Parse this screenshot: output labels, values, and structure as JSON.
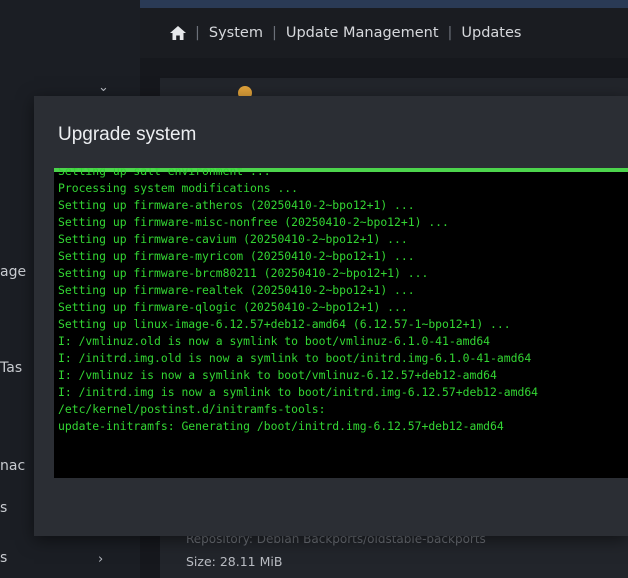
{
  "sidebar": {
    "fragments": [
      "",
      "age",
      "Tas",
      "nac",
      "s",
      "s"
    ]
  },
  "breadcrumb": {
    "home_icon": "home-icon",
    "items": [
      "System",
      "Update Management",
      "Updates"
    ]
  },
  "background_package": {
    "repository": "Repository: Debian Backports/oldstable-backports",
    "size": "Size: 28.11 MiB"
  },
  "modal": {
    "title": "Upgrade system",
    "progress_percent": 100,
    "log_lines": [
      "Setting up salt environment ...",
      "Processing system modifications ...",
      "Setting up firmware-atheros (20250410-2~bpo12+1) ...",
      "Setting up firmware-misc-nonfree (20250410-2~bpo12+1) ...",
      "Setting up firmware-cavium (20250410-2~bpo12+1) ...",
      "Setting up firmware-myricom (20250410-2~bpo12+1) ...",
      "Setting up firmware-brcm80211 (20250410-2~bpo12+1) ...",
      "Setting up firmware-realtek (20250410-2~bpo12+1) ...",
      "Setting up firmware-qlogic (20250410-2~bpo12+1) ...",
      "Setting up linux-image-6.12.57+deb12-amd64 (6.12.57-1~bpo12+1) ...",
      "I: /vmlinuz.old is now a symlink to boot/vmlinuz-6.1.0-41-amd64",
      "I: /initrd.img.old is now a symlink to boot/initrd.img-6.1.0-41-amd64",
      "I: /vmlinuz is now a symlink to boot/vmlinuz-6.12.57+deb12-amd64",
      "I: /initrd.img is now a symlink to boot/initrd.img-6.12.57+deb12-amd64",
      "/etc/kernel/postinst.d/initramfs-tools:",
      "update-initramfs: Generating /boot/initrd.img-6.12.57+deb12-amd64"
    ]
  }
}
